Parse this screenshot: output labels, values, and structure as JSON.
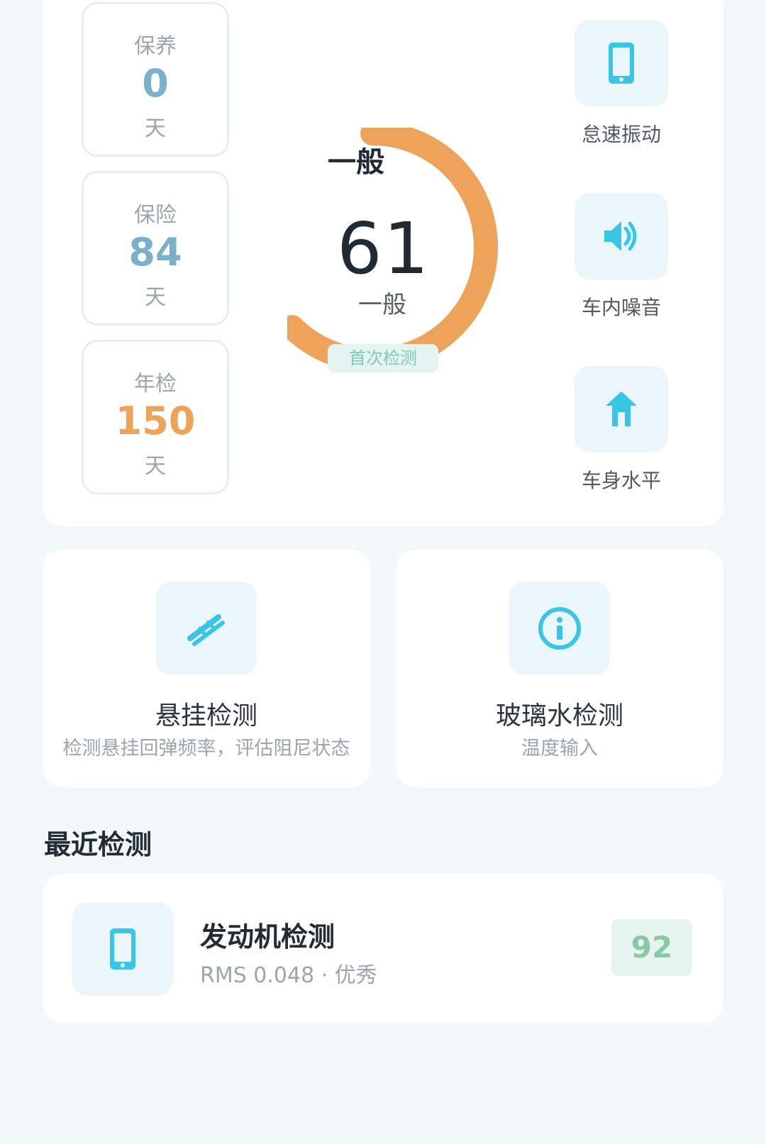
{
  "stats": [
    {
      "label": "保养",
      "value": "0",
      "unit": "天"
    },
    {
      "label": "保险",
      "value": "84",
      "unit": "天"
    },
    {
      "label": "年检",
      "value": "150",
      "unit": "天"
    }
  ],
  "gauge": {
    "status_top": "一般",
    "score": "61",
    "score_status": "一般",
    "first_badge": "首次检测",
    "fraction": 0.61,
    "color": "#eea35a"
  },
  "quick_actions": [
    {
      "label": "怠速振动",
      "icon": "phone-icon"
    },
    {
      "label": "车内噪音",
      "icon": "speaker-icon"
    },
    {
      "label": "车身水平",
      "icon": "level-icon"
    }
  ],
  "features": [
    {
      "title": "悬挂检测",
      "desc": "检测悬挂回弹频率，评估阻尼状态",
      "icon": "suspension-icon"
    },
    {
      "title": "玻璃水检测",
      "desc": "温度输入",
      "icon": "info-icon"
    }
  ],
  "recent": {
    "section_title": "最近检测",
    "title": "发动机检测",
    "sub": "RMS 0.048 · 优秀",
    "score": "92",
    "icon": "phone-icon"
  },
  "colors": {
    "accent": "#38c6e6",
    "tile_bg": "#eaf6f9",
    "orange": "#eea35a",
    "green": "#86c9a3"
  }
}
